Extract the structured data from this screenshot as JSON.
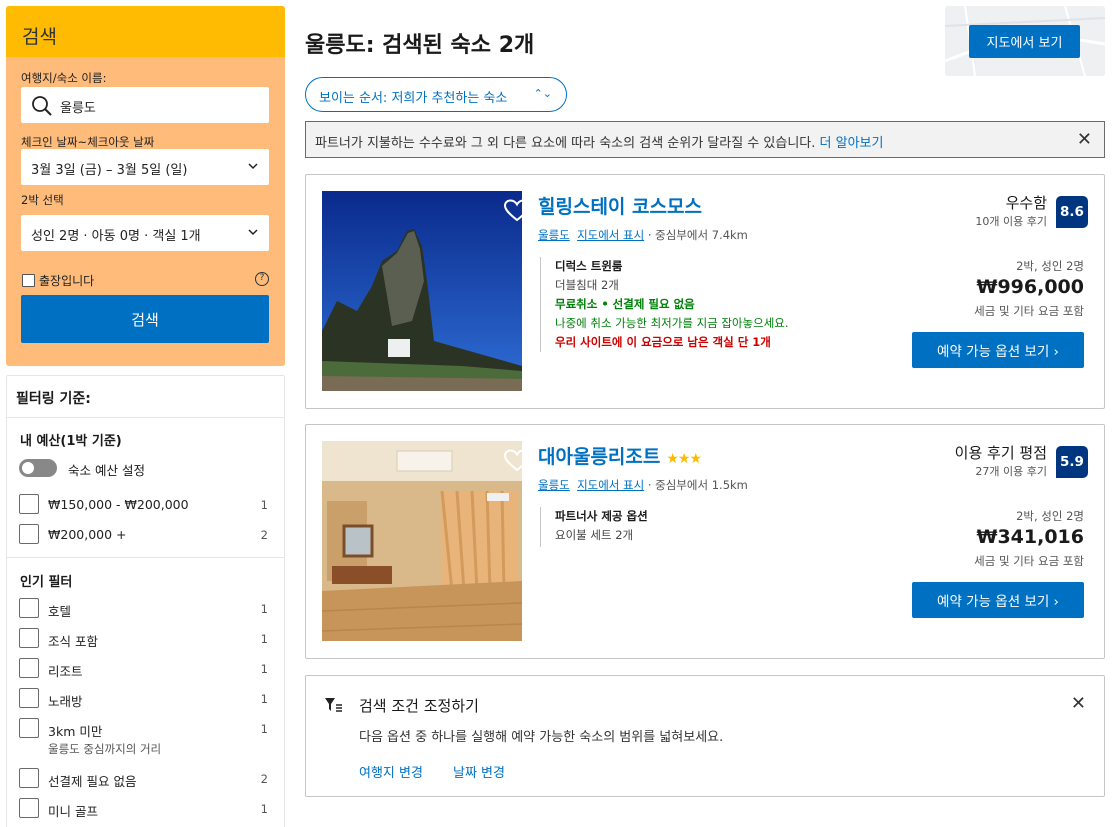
{
  "search": {
    "header": "검색",
    "destination_label": "여행지/숙소 이름:",
    "destination_value": "울릉도",
    "dates_label": "체크인 날짜~체크아웃 날짜",
    "dates_value": "3월 3일 (금) – 3월 5일 (일)",
    "nights_label": "2박 선택",
    "guests_value": "성인 2명 · 아동 0명 · 객실 1개",
    "business_trip_label": "출장입니다",
    "help": "?",
    "search_button": "검색"
  },
  "filters": {
    "title": "필터링 기준:",
    "budget_title": "내 예산(1박 기준)",
    "budget_toggle_label": "숙소 예산 설정",
    "budget_items": [
      {
        "label": "₩150,000 - ₩200,000",
        "count": "1"
      },
      {
        "label": "₩200,000 +",
        "count": "2"
      }
    ],
    "popular_title": "인기 필터",
    "popular_items": [
      {
        "label": "호텔",
        "count": "1"
      },
      {
        "label": "조식 포함",
        "count": "1"
      },
      {
        "label": "리조트",
        "count": "1"
      },
      {
        "label": "노래방",
        "count": "1"
      },
      {
        "label": "3km 미만",
        "count": "1",
        "sub": "울릉도 중심까지의 거리"
      },
      {
        "label": "선결제 필요 없음",
        "count": "2"
      },
      {
        "label": "미니 골프",
        "count": "1"
      }
    ]
  },
  "main": {
    "title": "울릉도: 검색된 숙소 2개",
    "map_button": "지도에서 보기",
    "sort_label": "보이는 순서: 저희가 추천하는 숙소",
    "notice_text": "파트너가 지불하는 수수료와 그 외 다른 요소에 따라 숙소의 검색 순위가 달라질 수 있습니다.",
    "notice_link": "더 알아보기",
    "close": "✕"
  },
  "hotels": [
    {
      "name": "힐링스테이 코스모스",
      "stars": "",
      "city": "울릉도",
      "map_link": "지도에서 표시",
      "distance": "· 중심부에서 7.4km",
      "room_name": "디럭스 트윈룸",
      "bed": "더블침대 2개",
      "free_cancel": "무료취소 • 선결제 필요 없음",
      "cancel_note": "나중에 취소 가능한 최저가를 지금 잡아놓으세요.",
      "scarcity": "우리 사이트에 이 요금으로 남은 객실 단 1개",
      "score_label": "우수함",
      "review_count": "10개 이용 후기",
      "score": "8.6",
      "nights": "2박, 성인 2명",
      "price": "₩996,000",
      "tax": "세금 및 기타 요금 포함",
      "button": "예약 가능 옵션 보기  ›"
    },
    {
      "name": "대아울릉리조트",
      "stars": "★★★",
      "city": "울릉도",
      "map_link": "지도에서 표시",
      "distance": "· 중심부에서 1.5km",
      "room_name": "파트너사 제공 옵션",
      "bed": "요이불 세트 2개",
      "score_label": "이용 후기 평점",
      "review_count": "27개 이용 후기",
      "score": "5.9",
      "nights": "2박, 성인 2명",
      "price": "₩341,016",
      "tax": "세금 및 기타 요금 포함",
      "button": "예약 가능 옵션 보기  ›"
    }
  ],
  "adjust": {
    "title": "검색 조건 조정하기",
    "desc": "다음 옵션 중 하나를 실행해 예약 가능한 숙소의 범위를 넓혀보세요.",
    "link1": "여행지 변경",
    "link2": "날짜 변경"
  },
  "colors": {
    "accent": "#0071c2",
    "header_yellow": "#febb02",
    "panel": "#febb7a",
    "score_bg": "#003580"
  }
}
